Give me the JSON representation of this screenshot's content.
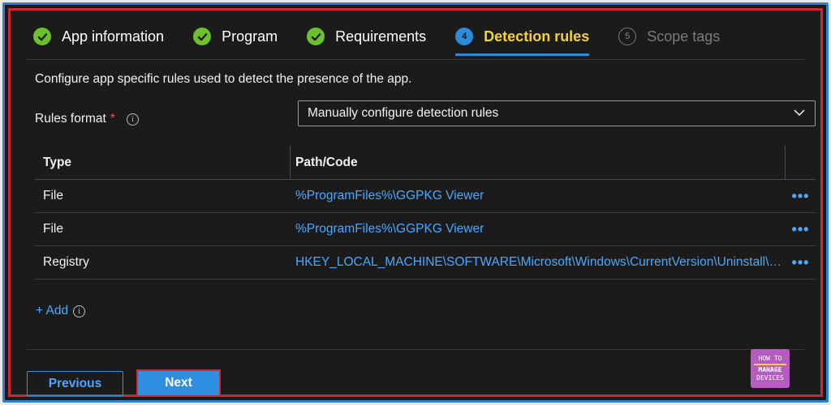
{
  "tabs": [
    {
      "label": "App information",
      "state": "done"
    },
    {
      "label": "Program",
      "state": "done"
    },
    {
      "label": "Requirements",
      "state": "done"
    },
    {
      "number": "4",
      "label": "Detection rules",
      "state": "active"
    },
    {
      "number": "5",
      "label": "Scope tags",
      "state": "disabled"
    }
  ],
  "description": "Configure app specific rules used to detect the presence of the app.",
  "rules_format": {
    "label": "Rules format",
    "required": "*",
    "info": "i",
    "selected": "Manually configure detection rules"
  },
  "table": {
    "headers": {
      "type": "Type",
      "path": "Path/Code"
    },
    "rows": [
      {
        "type": "File",
        "path": "%ProgramFiles%\\GGPKG Viewer",
        "more": "•••"
      },
      {
        "type": "File",
        "path": "%ProgramFiles%\\GGPKG Viewer",
        "more": "•••"
      },
      {
        "type": "Registry",
        "path": "HKEY_LOCAL_MACHINE\\SOFTWARE\\Microsoft\\Windows\\CurrentVersion\\Uninstall\\GGPKG Viewer",
        "more": "•••"
      }
    ]
  },
  "add": {
    "label": "+ Add",
    "info": "i"
  },
  "buttons": {
    "previous": "Previous",
    "next": "Next"
  },
  "logo": {
    "line1": "HOW TO",
    "line2": "MANAGE",
    "line3": "DEVICES"
  },
  "colors": {
    "accent": "#2e8bd8",
    "active_tab": "#f3d22d",
    "link": "#4aa8ff",
    "check": "#6cbf2e",
    "highlight_border": "#d0262f"
  }
}
